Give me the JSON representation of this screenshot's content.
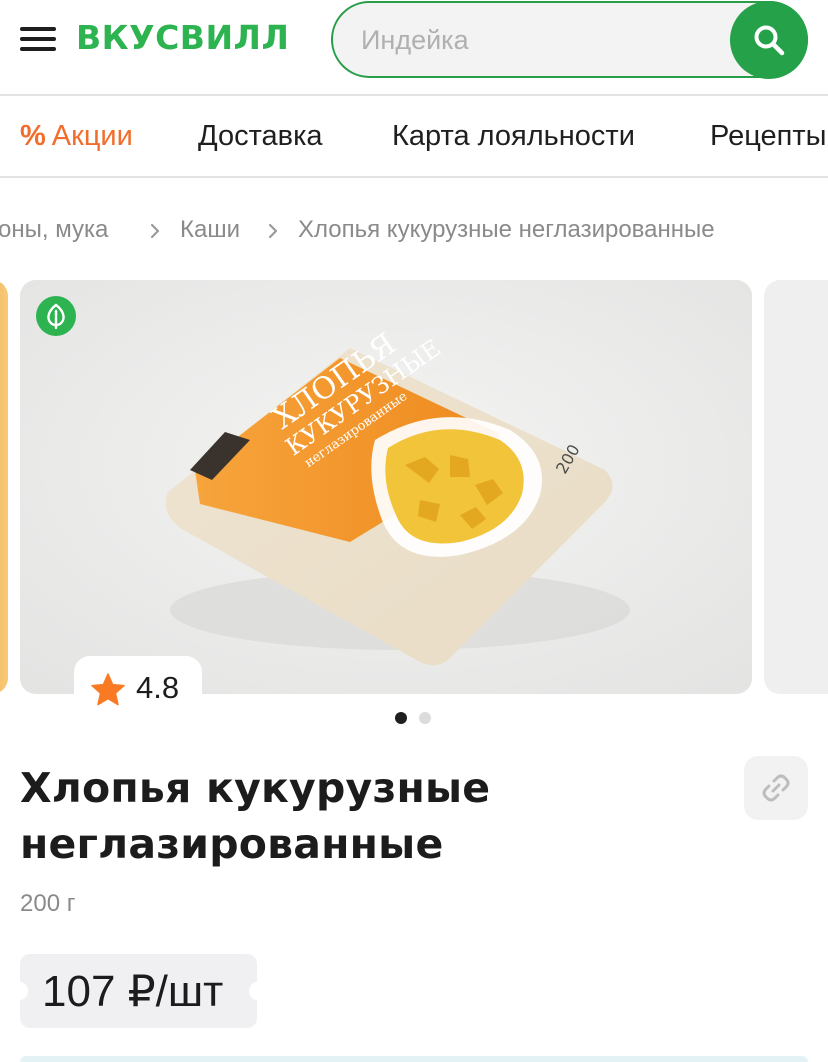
{
  "header": {
    "logo": "ВКУСВИЛЛ",
    "search_placeholder": "Индейка",
    "search_value": ""
  },
  "nav": {
    "items": [
      {
        "label": "Акции",
        "icon": "percent-icon"
      },
      {
        "label": "Доставка"
      },
      {
        "label": "Карта лояльности"
      },
      {
        "label": "Рецепты"
      }
    ]
  },
  "breadcrumb": {
    "items": [
      "оны, мука",
      "Каши",
      "Хлопья кукурузные неглазированные"
    ]
  },
  "gallery": {
    "badge_icon": "leaf-icon",
    "rating_icon": "star-icon",
    "rating": "4.8",
    "dots": 2,
    "active_dot": 1,
    "package_text": {
      "line1": "ХЛОПЬЯ",
      "line2": "КУКУРУЗНЫЕ",
      "line3": "неглазированные",
      "weight_mark": "200"
    }
  },
  "product": {
    "title": "Хлопья кукурузные неглазированные",
    "weight": "200 г",
    "price": "107 ₽/шт",
    "share_icon": "link-icon"
  },
  "colors": {
    "brand_green": "#2db350",
    "search_button": "#24a149",
    "promo_orange": "#f26d2b",
    "star": "#f97a23"
  }
}
